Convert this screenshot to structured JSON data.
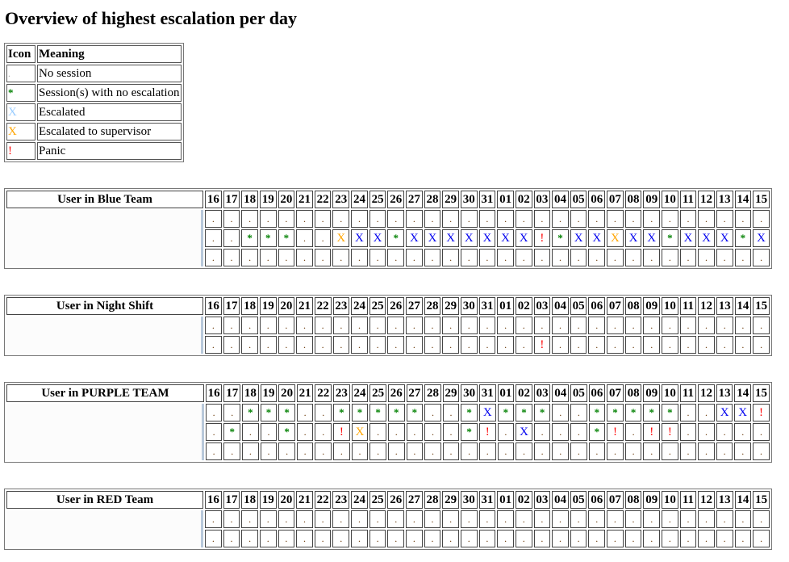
{
  "title": "Overview of highest escalation per day",
  "legend": {
    "headers": {
      "icon": "Icon",
      "meaning": "Meaning"
    },
    "items": [
      {
        "icon": "no-session-icon",
        "symbol": ".",
        "cls": "sym-dot-legend",
        "meaning": "No session"
      },
      {
        "icon": "session-no-escalation-icon",
        "symbol": "*",
        "cls": "sym-star",
        "meaning": "Session(s) with no escalation"
      },
      {
        "icon": "escalated-icon",
        "symbol": "X",
        "cls": "sym-x-legend",
        "meaning": "Escalated"
      },
      {
        "icon": "escalated-supervisor-icon",
        "symbol": "X",
        "cls": "sym-xo",
        "meaning": "Escalated to supervisor"
      },
      {
        "icon": "panic-icon",
        "symbol": "!",
        "cls": "sym-bang",
        "meaning": "Panic"
      }
    ]
  },
  "status_colors": {
    "no_session": "#663300",
    "no_escalation": "#008000",
    "escalated": "#0000ee",
    "escalated_legend": "#99ccff",
    "escalated_to_supervisor": "#ffa500",
    "panic": "#ff0000"
  },
  "days": [
    "16",
    "17",
    "18",
    "19",
    "20",
    "21",
    "22",
    "23",
    "24",
    "25",
    "26",
    "27",
    "28",
    "29",
    "30",
    "31",
    "01",
    "02",
    "03",
    "04",
    "05",
    "06",
    "07",
    "08",
    "09",
    "10",
    "11",
    "12",
    "13",
    "14",
    "15"
  ],
  "teams": [
    {
      "header": "User in Blue Team",
      "rows": [
        ".............................. .",
        "..***..XX*XXXXXXX!*XXOXX*XXX*X",
        "..............................."
      ],
      "grid": [
        [
          ".",
          ".",
          ".",
          ".",
          ".",
          ".",
          ".",
          ".",
          ".",
          ".",
          ".",
          ".",
          ".",
          ".",
          ".",
          ".",
          ".",
          ".",
          ".",
          ".",
          ".",
          ".",
          ".",
          ".",
          ".",
          ".",
          ".",
          ".",
          ".",
          ".",
          "."
        ],
        [
          ".",
          ".",
          "*",
          "*",
          "*",
          ".",
          ".",
          "O",
          "X",
          "X",
          "*",
          "X",
          "X",
          "X",
          "X",
          "X",
          "X",
          "X",
          "!",
          "*",
          "X",
          "X",
          "O",
          "X",
          "X",
          "*",
          "X",
          "X",
          "X",
          "*",
          "X"
        ],
        [
          ".",
          ".",
          ".",
          ".",
          ".",
          ".",
          ".",
          ".",
          ".",
          ".",
          ".",
          ".",
          ".",
          ".",
          ".",
          ".",
          ".",
          ".",
          ".",
          ".",
          ".",
          ".",
          ".",
          ".",
          ".",
          ".",
          ".",
          ".",
          ".",
          ".",
          "."
        ]
      ]
    },
    {
      "header": "User in Night Shift",
      "grid": [
        [
          ".",
          ".",
          ".",
          ".",
          ".",
          ".",
          ".",
          ".",
          ".",
          ".",
          ".",
          ".",
          ".",
          ".",
          ".",
          ".",
          ".",
          ".",
          ".",
          ".",
          ".",
          ".",
          ".",
          ".",
          ".",
          ".",
          ".",
          ".",
          ".",
          ".",
          "."
        ],
        [
          ".",
          ".",
          ".",
          ".",
          ".",
          ".",
          ".",
          ".",
          ".",
          ".",
          ".",
          ".",
          ".",
          ".",
          ".",
          ".",
          ".",
          ".",
          "!",
          ".",
          ".",
          ".",
          ".",
          ".",
          ".",
          ".",
          ".",
          ".",
          ".",
          ".",
          "."
        ]
      ]
    },
    {
      "header": "User in PURPLE TEAM",
      "grid": [
        [
          ".",
          ".",
          "*",
          "*",
          "*",
          ".",
          ".",
          "*",
          "*",
          "*",
          "*",
          "*",
          ".",
          ".",
          "*",
          "X",
          "*",
          "*",
          "*",
          ".",
          ".",
          "*",
          "*",
          "*",
          "*",
          "*",
          ".",
          ".",
          "X",
          "X",
          "!"
        ],
        [
          ".",
          "*",
          ".",
          ".",
          "*",
          ".",
          ".",
          "!",
          "O",
          ".",
          ".",
          ".",
          ".",
          ".",
          "*",
          "!",
          ".",
          "X",
          ".",
          ".",
          ".",
          "*",
          "!",
          ".",
          "!",
          "!",
          ".",
          ".",
          ".",
          ".",
          "."
        ],
        [
          ".",
          ".",
          ".",
          ".",
          ".",
          ".",
          ".",
          ".",
          ".",
          ".",
          ".",
          ".",
          ".",
          ".",
          ".",
          ".",
          ".",
          ".",
          ".",
          ".",
          ".",
          ".",
          ".",
          ".",
          ".",
          ".",
          ".",
          ".",
          ".",
          ".",
          "."
        ]
      ]
    },
    {
      "header": "User in RED Team",
      "grid": [
        [
          ".",
          ".",
          ".",
          ".",
          ".",
          ".",
          ".",
          ".",
          ".",
          ".",
          ".",
          ".",
          ".",
          ".",
          ".",
          ".",
          ".",
          ".",
          ".",
          ".",
          ".",
          ".",
          ".",
          ".",
          ".",
          ".",
          ".",
          ".",
          ".",
          ".",
          "."
        ],
        [
          ".",
          ".",
          ".",
          ".",
          ".",
          ".",
          ".",
          ".",
          ".",
          ".",
          ".",
          ".",
          ".",
          ".",
          ".",
          ".",
          ".",
          ".",
          ".",
          ".",
          ".",
          ".",
          ".",
          ".",
          ".",
          ".",
          ".",
          ".",
          ".",
          ".",
          "."
        ]
      ]
    }
  ],
  "symbol_key": {
    ".": {
      "symbol": ".",
      "cls": "sym-dot",
      "name": "no-session-icon"
    },
    "*": {
      "symbol": "*",
      "cls": "sym-star",
      "name": "session-no-escalation-icon"
    },
    "X": {
      "symbol": "X",
      "cls": "sym-x",
      "name": "escalated-icon"
    },
    "O": {
      "symbol": "X",
      "cls": "sym-xo",
      "name": "escalated-supervisor-icon"
    },
    "!": {
      "symbol": "!",
      "cls": "sym-bang",
      "name": "panic-icon"
    }
  }
}
